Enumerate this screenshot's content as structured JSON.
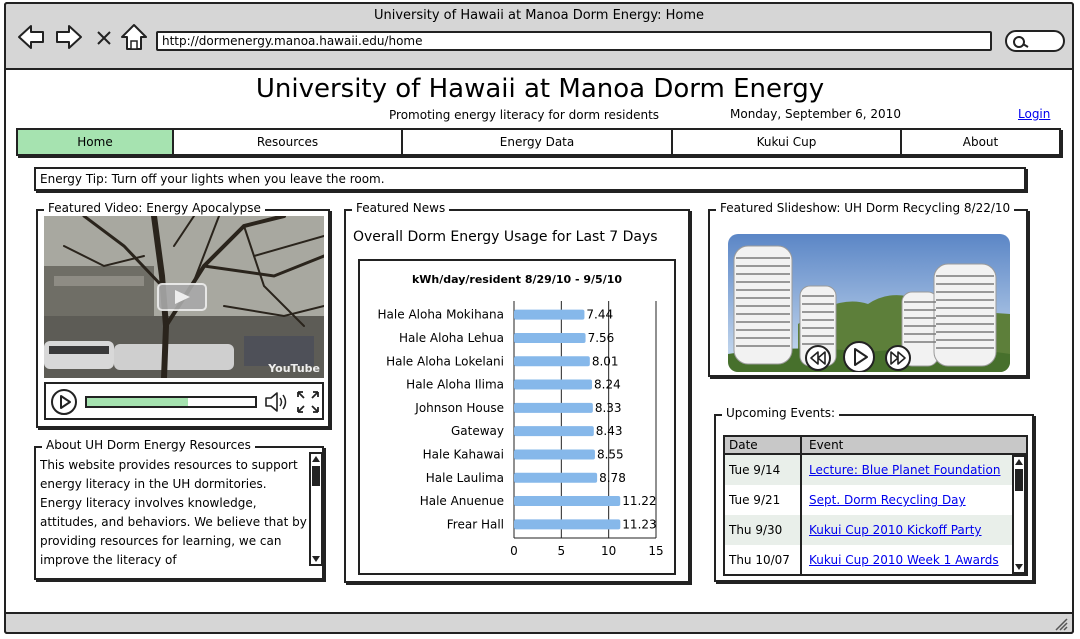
{
  "window": {
    "title": "University of Hawaii at Manoa Dorm Energy: Home"
  },
  "browser": {
    "url": "http://dormenergy.manoa.hawaii.edu/home"
  },
  "header": {
    "title": "University of Hawaii at Manoa Dorm Energy",
    "tagline": "Promoting energy literacy for dorm residents",
    "date": "Monday, September 6, 2010",
    "login": "Login"
  },
  "nav": {
    "tabs": [
      {
        "label": "Home",
        "active": true
      },
      {
        "label": "Resources"
      },
      {
        "label": "Energy Data"
      },
      {
        "label": "Kukui Cup"
      },
      {
        "label": "About"
      }
    ]
  },
  "tip": "Energy Tip: Turn off your lights when you leave the room.",
  "video": {
    "title": "Featured Video: Energy Apocalypse",
    "progress": 0.6,
    "brand": "YouTube"
  },
  "about": {
    "title": "About UH Dorm Energy Resources",
    "text": "This website provides resources to support energy literacy in the UH dormitories.  Energy literacy involves knowledge, attitudes, and behaviors.  We believe that by providing resources for learning, we can improve the literacy of"
  },
  "news": {
    "title": "Featured News",
    "chart_heading": "Overall Dorm Energy Usage for Last 7 Days"
  },
  "chart_data": {
    "type": "bar",
    "orientation": "horizontal",
    "title": "kWh/day/resident  8/29/10 - 9/5/10",
    "categories": [
      "Hale Aloha Mokihana",
      "Hale Aloha Lehua",
      "Hale Aloha Lokelani",
      "Hale Aloha Ilima",
      "Johnson House",
      "Gateway",
      "Hale Kahawai",
      "Hale Laulima",
      "Hale Anuenue",
      "Frear Hall"
    ],
    "values": [
      7.44,
      7.56,
      8.01,
      8.24,
      8.33,
      8.43,
      8.55,
      8.78,
      11.22,
      11.23
    ],
    "value_labels": [
      "7.44",
      "7.56",
      "8.01",
      "8.24",
      "8.33",
      "8.43",
      "8.55",
      "8.78",
      "11.22",
      "11.23"
    ],
    "xlim": [
      0,
      15
    ],
    "ticks": [
      "0",
      "5",
      "10",
      "15"
    ],
    "grid": true,
    "bar_color": "#86b8ea"
  },
  "slideshow": {
    "title": "Featured Slideshow:  UH Dorm Recycling 8/22/10"
  },
  "events": {
    "title": "Upcoming Events:",
    "columns": [
      "Date",
      "Event"
    ],
    "rows": [
      {
        "date": "Tue 9/14",
        "event": "Lecture: Blue Planet Foundation"
      },
      {
        "date": "Tue 9/21",
        "event": "Sept. Dorm Recycling Day"
      },
      {
        "date": "Thu 9/30",
        "event": "Kukui Cup 2010 Kickoff Party"
      },
      {
        "date": "Thu 10/07",
        "event": "Kukui Cup 2010 Week 1 Awards"
      }
    ]
  }
}
